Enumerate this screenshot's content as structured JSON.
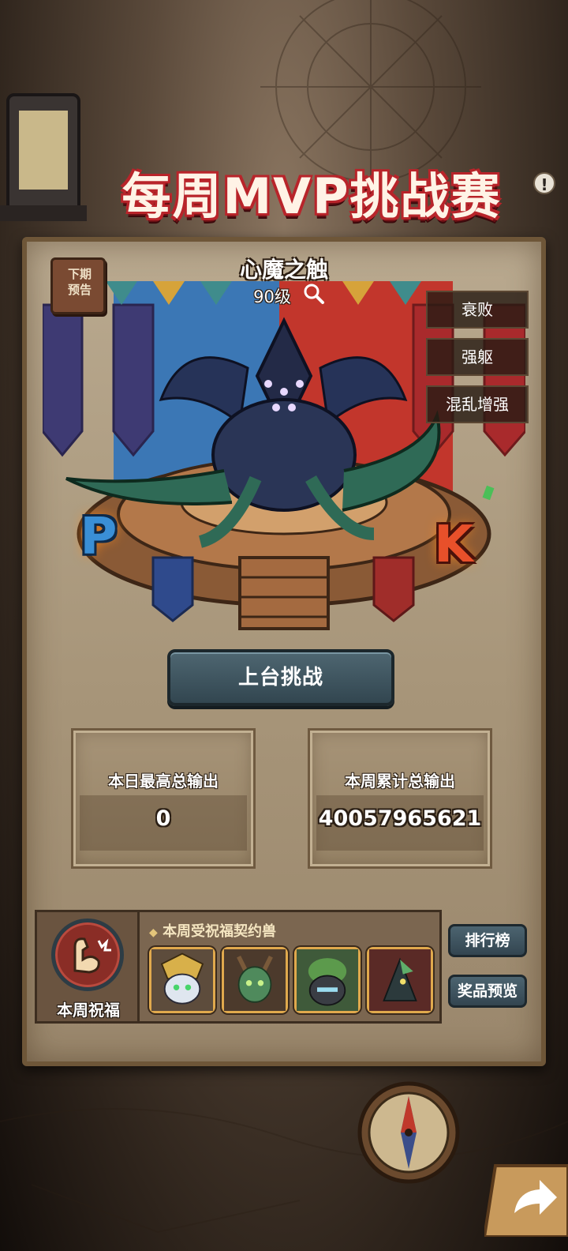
{
  "title": "每周MVP挑战赛",
  "title_info_icon": "!",
  "next_period_badge": "下期\n预告",
  "boss": {
    "name": "心魔之触",
    "level": "90级"
  },
  "debuffs": [
    "衰败",
    "强躯",
    "混乱增强"
  ],
  "pk_letters": [
    "P",
    "K"
  ],
  "challenge_button": "上台挑战",
  "stats": [
    {
      "label": "本日最高总输出",
      "value": "0"
    },
    {
      "label": "本周累计总输出",
      "value": "40057965621"
    }
  ],
  "blessing": {
    "label": "本周祝福",
    "heading": "本周受祝福契约兽",
    "pets": [
      "pet-white-armored-icon",
      "pet-horned-green-icon",
      "pet-moss-golem-icon",
      "pet-dark-bird-icon"
    ]
  },
  "side_buttons": [
    "排行榜",
    "奖品预览"
  ],
  "colors": {
    "title_outline": "#b8242a",
    "button_blue": "#4e6671",
    "board": "#b9a98f",
    "pet_frame": "#e0a94d"
  }
}
